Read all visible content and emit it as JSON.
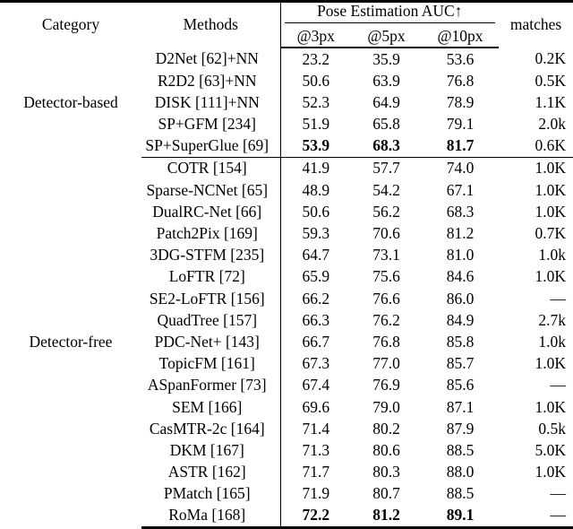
{
  "table": {
    "columns": {
      "category": "Category",
      "methods": "Methods",
      "group_header": "Pose Estimation AUC↑",
      "auc_3px": "@3px",
      "auc_5px": "@5px",
      "auc_10px": "@10px",
      "matches": "matches"
    },
    "groups": [
      {
        "name": "Detector-based",
        "rows": [
          {
            "method": "D2Net [62]+NN",
            "auc3": "23.2",
            "auc5": "35.9",
            "auc10": "53.6",
            "matches": "0.2K",
            "bold": false
          },
          {
            "method": "R2D2 [63]+NN",
            "auc3": "50.6",
            "auc5": "63.9",
            "auc10": "76.8",
            "matches": "0.5K",
            "bold": false
          },
          {
            "method": "DISK [111]+NN",
            "auc3": "52.3",
            "auc5": "64.9",
            "auc10": "78.9",
            "matches": "1.1K",
            "bold": false
          },
          {
            "method": "SP+GFM [234]",
            "auc3": "51.9",
            "auc5": "65.8",
            "auc10": "79.1",
            "matches": "2.0k",
            "bold": false
          },
          {
            "method": "SP+SuperGlue [69]",
            "auc3": "53.9",
            "auc5": "68.3",
            "auc10": "81.7",
            "matches": "0.6K",
            "bold": true
          }
        ]
      },
      {
        "name": "Detector-free",
        "rows": [
          {
            "method": "COTR [154]",
            "auc3": "41.9",
            "auc5": "57.7",
            "auc10": "74.0",
            "matches": "1.0K",
            "bold": false
          },
          {
            "method": "Sparse-NCNet [65]",
            "auc3": "48.9",
            "auc5": "54.2",
            "auc10": "67.1",
            "matches": "1.0K",
            "bold": false
          },
          {
            "method": "DualRC-Net [66]",
            "auc3": "50.6",
            "auc5": "56.2",
            "auc10": "68.3",
            "matches": "1.0K",
            "bold": false
          },
          {
            "method": "Patch2Pix [169]",
            "auc3": "59.3",
            "auc5": "70.6",
            "auc10": "81.2",
            "matches": "0.7K",
            "bold": false
          },
          {
            "method": "3DG-STFM [235]",
            "auc3": "64.7",
            "auc5": "73.1",
            "auc10": "81.0",
            "matches": "1.0k",
            "bold": false
          },
          {
            "method": "LoFTR [72]",
            "auc3": "65.9",
            "auc5": "75.6",
            "auc10": "84.6",
            "matches": "1.0K",
            "bold": false
          },
          {
            "method": "SE2-LoFTR [156]",
            "auc3": "66.2",
            "auc5": "76.6",
            "auc10": "86.0",
            "matches": "—",
            "bold": false
          },
          {
            "method": "QuadTree [157]",
            "auc3": "66.3",
            "auc5": "76.2",
            "auc10": "84.9",
            "matches": "2.7k",
            "bold": false
          },
          {
            "method": "PDC-Net+ [143]",
            "auc3": "66.7",
            "auc5": "76.8",
            "auc10": "85.8",
            "matches": "1.0k",
            "bold": false
          },
          {
            "method": "TopicFM [161]",
            "auc3": "67.3",
            "auc5": "77.0",
            "auc10": "85.7",
            "matches": "1.0K",
            "bold": false
          },
          {
            "method": "ASpanFormer [73]",
            "auc3": "67.4",
            "auc5": "76.9",
            "auc10": "85.6",
            "matches": "—",
            "bold": false
          },
          {
            "method": "SEM [166]",
            "auc3": "69.6",
            "auc5": "79.0",
            "auc10": "87.1",
            "matches": "1.0K",
            "bold": false
          },
          {
            "method": "CasMTR-2c [164]",
            "auc3": "71.4",
            "auc5": "80.2",
            "auc10": "87.9",
            "matches": "0.5k",
            "bold": false
          },
          {
            "method": "DKM [167]",
            "auc3": "71.3",
            "auc5": "80.6",
            "auc10": "88.5",
            "matches": "5.0K",
            "bold": false
          },
          {
            "method": "ASTR [162]",
            "auc3": "71.7",
            "auc5": "80.3",
            "auc10": "88.0",
            "matches": "1.0K",
            "bold": false
          },
          {
            "method": "PMatch [165]",
            "auc3": "71.9",
            "auc5": "80.7",
            "auc10": "88.5",
            "matches": "—",
            "bold": false
          },
          {
            "method": "RoMa [168]",
            "auc3": "72.2",
            "auc5": "81.2",
            "auc10": "89.1",
            "matches": "—",
            "bold": true
          }
        ]
      }
    ]
  }
}
